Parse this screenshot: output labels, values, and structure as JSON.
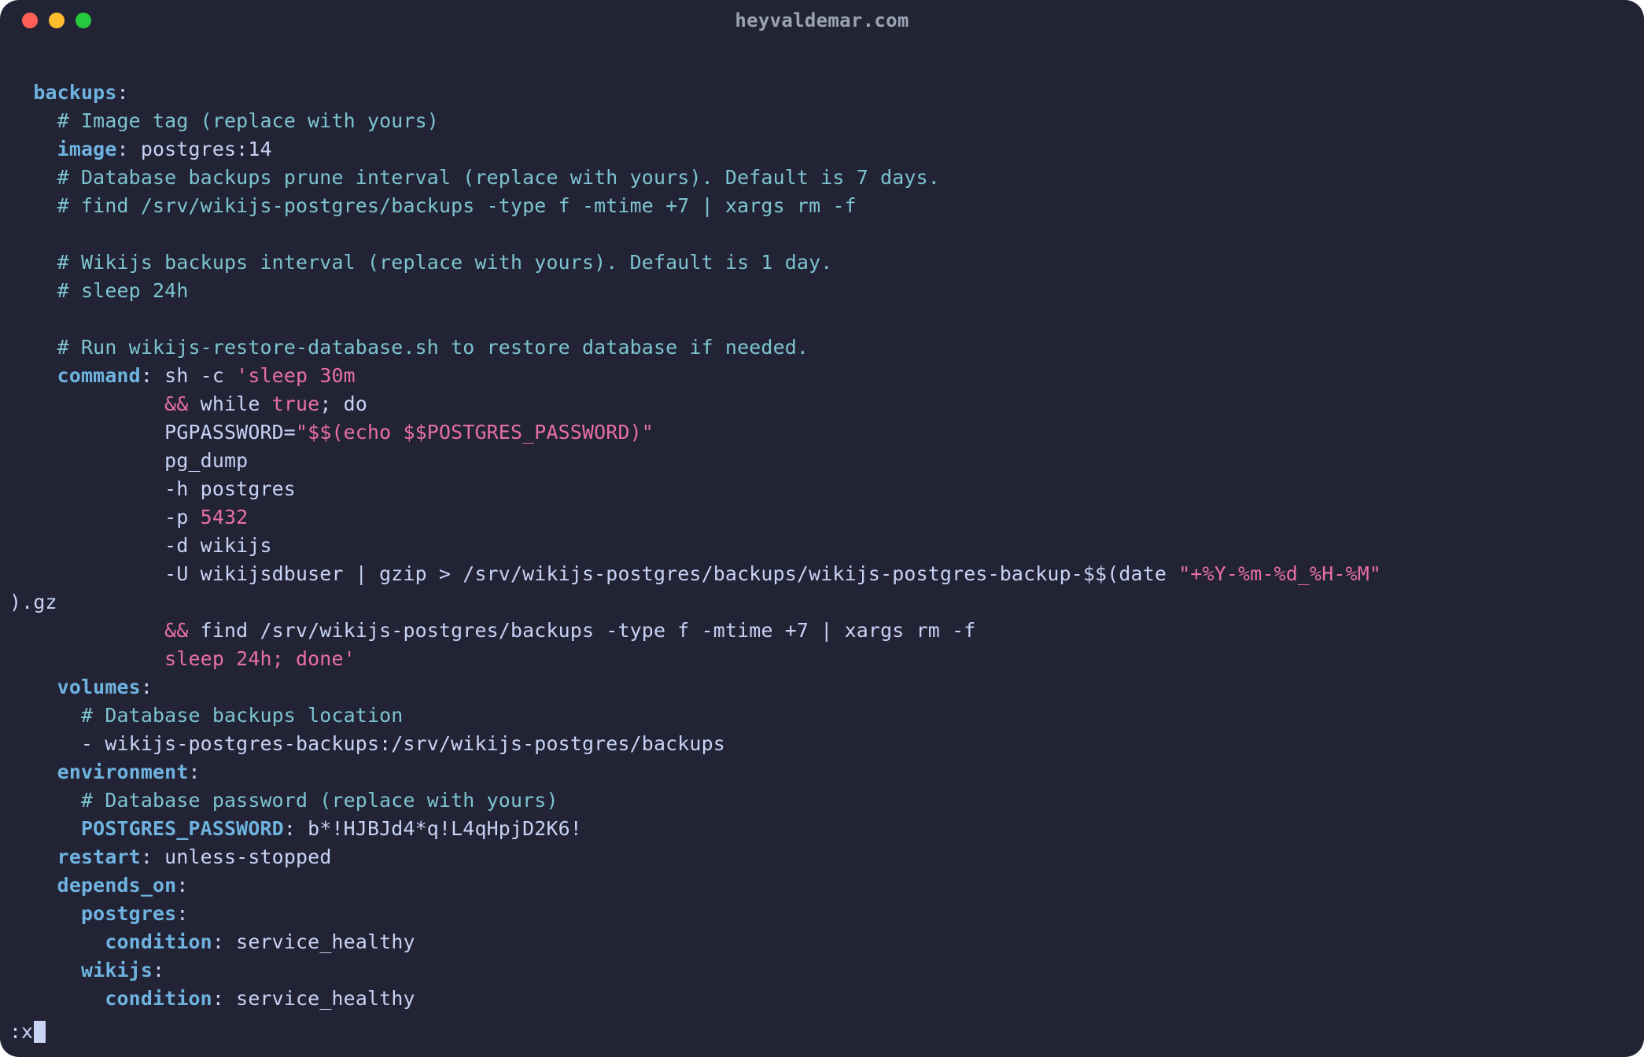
{
  "window": {
    "title": "heyvaldemar.com"
  },
  "status": {
    "prefix": ":x"
  },
  "indent": {
    "i1": "  ",
    "i2": "    ",
    "i3": "      ",
    "i4": "        ",
    "arg": "             "
  },
  "code": {
    "k_backups": "backups",
    "c_image_tag": "# Image tag (replace with yours)",
    "k_image": "image",
    "v_image": " postgres:14",
    "c_prune": "# Database backups prune interval (replace with yours). Default is 7 days.",
    "c_find": "# find /srv/wikijs-postgres/backups -type f -mtime +7 | xargs rm -f",
    "c_interval": "# Wikijs backups interval (replace with yours). Default is 1 day.",
    "c_sleep": "# sleep 24h",
    "c_restore": "# Run wikijs-restore-database.sh to restore database if needed.",
    "k_command": "command",
    "v_cmd_pre": " sh -c ",
    "s_cmd_q1": "'sleep 30m",
    "s_andand1": "&&",
    "v_while_pre": " while ",
    "s_true": "true",
    "v_while_post": "; do",
    "v_pgpass1": "PGPASSWORD=",
    "s_pgpass_dq": "\"$$(echo $$POSTGRES_PASSWORD)\"",
    "v_pgdump": "pg_dump",
    "v_h": "-h postgres",
    "v_p_pre": "-p ",
    "s_port": "5432",
    "v_d": "-d wikijs",
    "v_U_pre": "-U wikijsdbuser | gzip > /srv/wikijs-postgres/backups/wikijs-postgres-backup-$$(date ",
    "s_datefmt": "\"+%Y-%m-%d_%H-%M\"",
    "v_gz_wrap": ").gz",
    "s_andand2": "&&",
    "v_find2": " find /srv/wikijs-postgres/backups -type f -mtime +7 | xargs rm -f",
    "s_sleepdone": "sleep 24h; done'",
    "k_volumes": "volumes",
    "c_volloc": "# Database backups location",
    "v_volitem": "- wikijs-postgres-backups:/srv/wikijs-postgres/backups",
    "k_environment": "environment",
    "c_dbpw": "# Database password (replace with yours)",
    "k_pgpw": "POSTGRES_PASSWORD",
    "v_pgpw": " b*!HJBJd4*q!L4qHpjD2K6!",
    "k_restart": "restart",
    "v_restart": " unless-stopped",
    "k_depends": "depends_on",
    "k_dep_pg": "postgres",
    "k_dep_wiki": "wikijs",
    "k_condition": "condition",
    "v_condition": " service_healthy",
    "colon": ":"
  }
}
